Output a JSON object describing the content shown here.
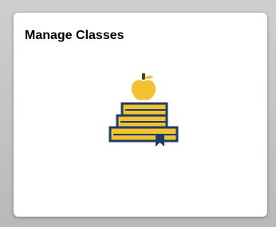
{
  "tile": {
    "title": "Manage Classes",
    "icon": "apple-on-books-icon"
  },
  "colors": {
    "page_background": "#bfbfbf",
    "tile_background": "#ffffff",
    "title_text": "#000000",
    "book_fill": "#f2c230",
    "book_outline": "#1f3d66",
    "apple": "#f2c230"
  }
}
